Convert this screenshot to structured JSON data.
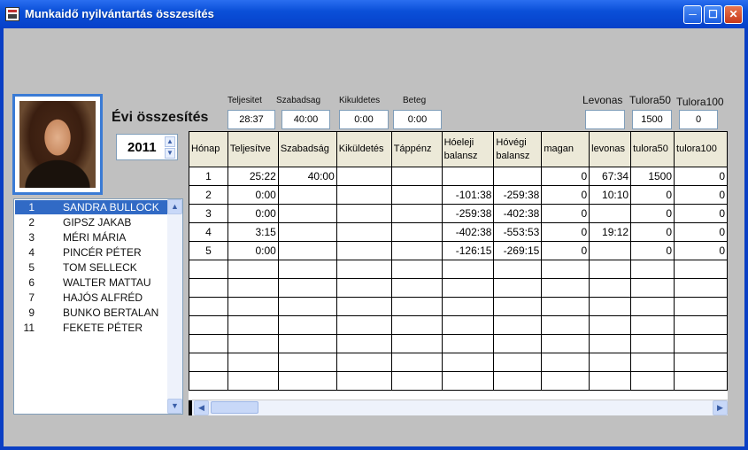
{
  "window": {
    "title": "Munkaidő nyilvántartás összesítés"
  },
  "summary": {
    "heading": "Évi összesítés",
    "year": "2011",
    "teljesitet_label": "Teljesitet",
    "teljesitet_value": "28:37",
    "szabadsag_label": "Szabadsag",
    "szabadsag_value": "40:00",
    "kikuldetes_label": "Kikuldetes",
    "kikuldetes_value": "0:00",
    "beteg_label": "Beteg",
    "beteg_value": "0:00",
    "levonas_label": "Levonas",
    "levonas_value": "",
    "tulora50_label": "Tulora50",
    "tulora50_value": "1500",
    "tulora100_label": "Tulora100",
    "tulora100_value": "0"
  },
  "employees": [
    {
      "num": "1",
      "name": "SANDRA BULLOCK",
      "selected": true
    },
    {
      "num": "2",
      "name": "GIPSZ JAKAB"
    },
    {
      "num": "3",
      "name": "MÉRI MÁRIA"
    },
    {
      "num": "4",
      "name": "PINCÉR PÉTER"
    },
    {
      "num": "5",
      "name": "TOM SELLECK"
    },
    {
      "num": "6",
      "name": "WALTER MATTAU"
    },
    {
      "num": "7",
      "name": "HAJÓS ALFRÉD"
    },
    {
      "num": "9",
      "name": "BUNKO BERTALAN"
    },
    {
      "num": "11",
      "name": "FEKETE PÉTER"
    }
  ],
  "grid": {
    "columns": [
      "Hónap",
      "Teljesítve",
      "Szabadság",
      "Kiküldetés",
      "Táppénz",
      "Hóeleji balansz",
      "Hóvégi balansz",
      "magan",
      "levonas",
      "tulora50",
      "tulora100"
    ],
    "rows": [
      [
        "1",
        "25:22",
        "40:00",
        "",
        "",
        "",
        "",
        "0",
        "67:34",
        "1500",
        "0"
      ],
      [
        "2",
        "0:00",
        "",
        "",
        "",
        "-101:38",
        "-259:38",
        "0",
        "10:10",
        "0",
        "0"
      ],
      [
        "3",
        "0:00",
        "",
        "",
        "",
        "-259:38",
        "-402:38",
        "0",
        "",
        "0",
        "0"
      ],
      [
        "4",
        "3:15",
        "",
        "",
        "",
        "-402:38",
        "-553:53",
        "0",
        "19:12",
        "0",
        "0"
      ],
      [
        "5",
        "0:00",
        "",
        "",
        "",
        "-126:15",
        "-269:15",
        "0",
        "",
        "0",
        "0"
      ]
    ],
    "empty_rows": 7
  },
  "icons": {
    "app": "app-icon",
    "minimize": "minimize-icon",
    "maximize": "maximize-icon",
    "close": "close-icon"
  }
}
